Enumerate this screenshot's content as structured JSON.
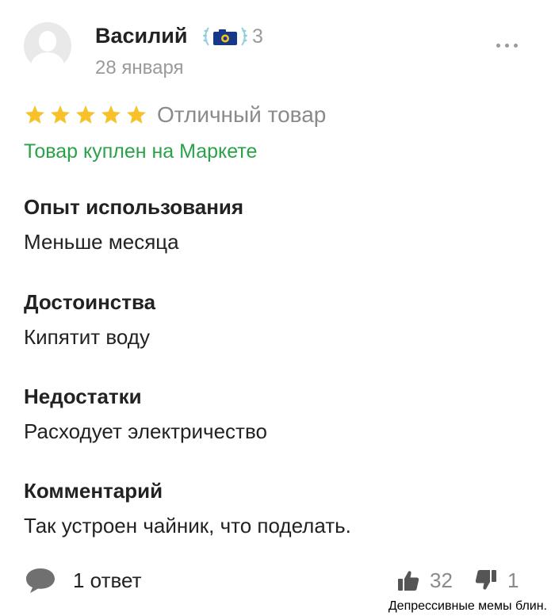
{
  "review": {
    "author": {
      "name": "Василий",
      "badge_count": "3",
      "date": "28 января",
      "avatar_icon": "user-avatar-icon",
      "badge_icon": "camera-laurel-badge-icon"
    },
    "more_icon": "more-dots-icon",
    "rating": {
      "stars": 5,
      "max_stars": 5,
      "label": "Отличный товар",
      "star_color": "#f7c12a"
    },
    "purchase_note": "Товар куплен на Маркете",
    "sections": [
      {
        "title": "Опыт использования",
        "text": "Меньше месяца"
      },
      {
        "title": "Достоинства",
        "text": "Кипятит воду"
      },
      {
        "title": "Недостатки",
        "text": "Расходует электричество"
      },
      {
        "title": "Комментарий",
        "text": "Так устроен чайник, что поделать."
      }
    ],
    "footer": {
      "replies_label": "1 ответ",
      "reply_icon": "speech-bubble-icon",
      "likes": "32",
      "like_icon": "thumbs-up-icon",
      "dislikes": "1",
      "dislike_icon": "thumbs-down-icon"
    }
  },
  "colors": {
    "accent_green": "#2aa24a",
    "muted_gray": "#9a9a9a",
    "text_dark": "#222222"
  },
  "watermark": "Депрессивные мемы блин."
}
